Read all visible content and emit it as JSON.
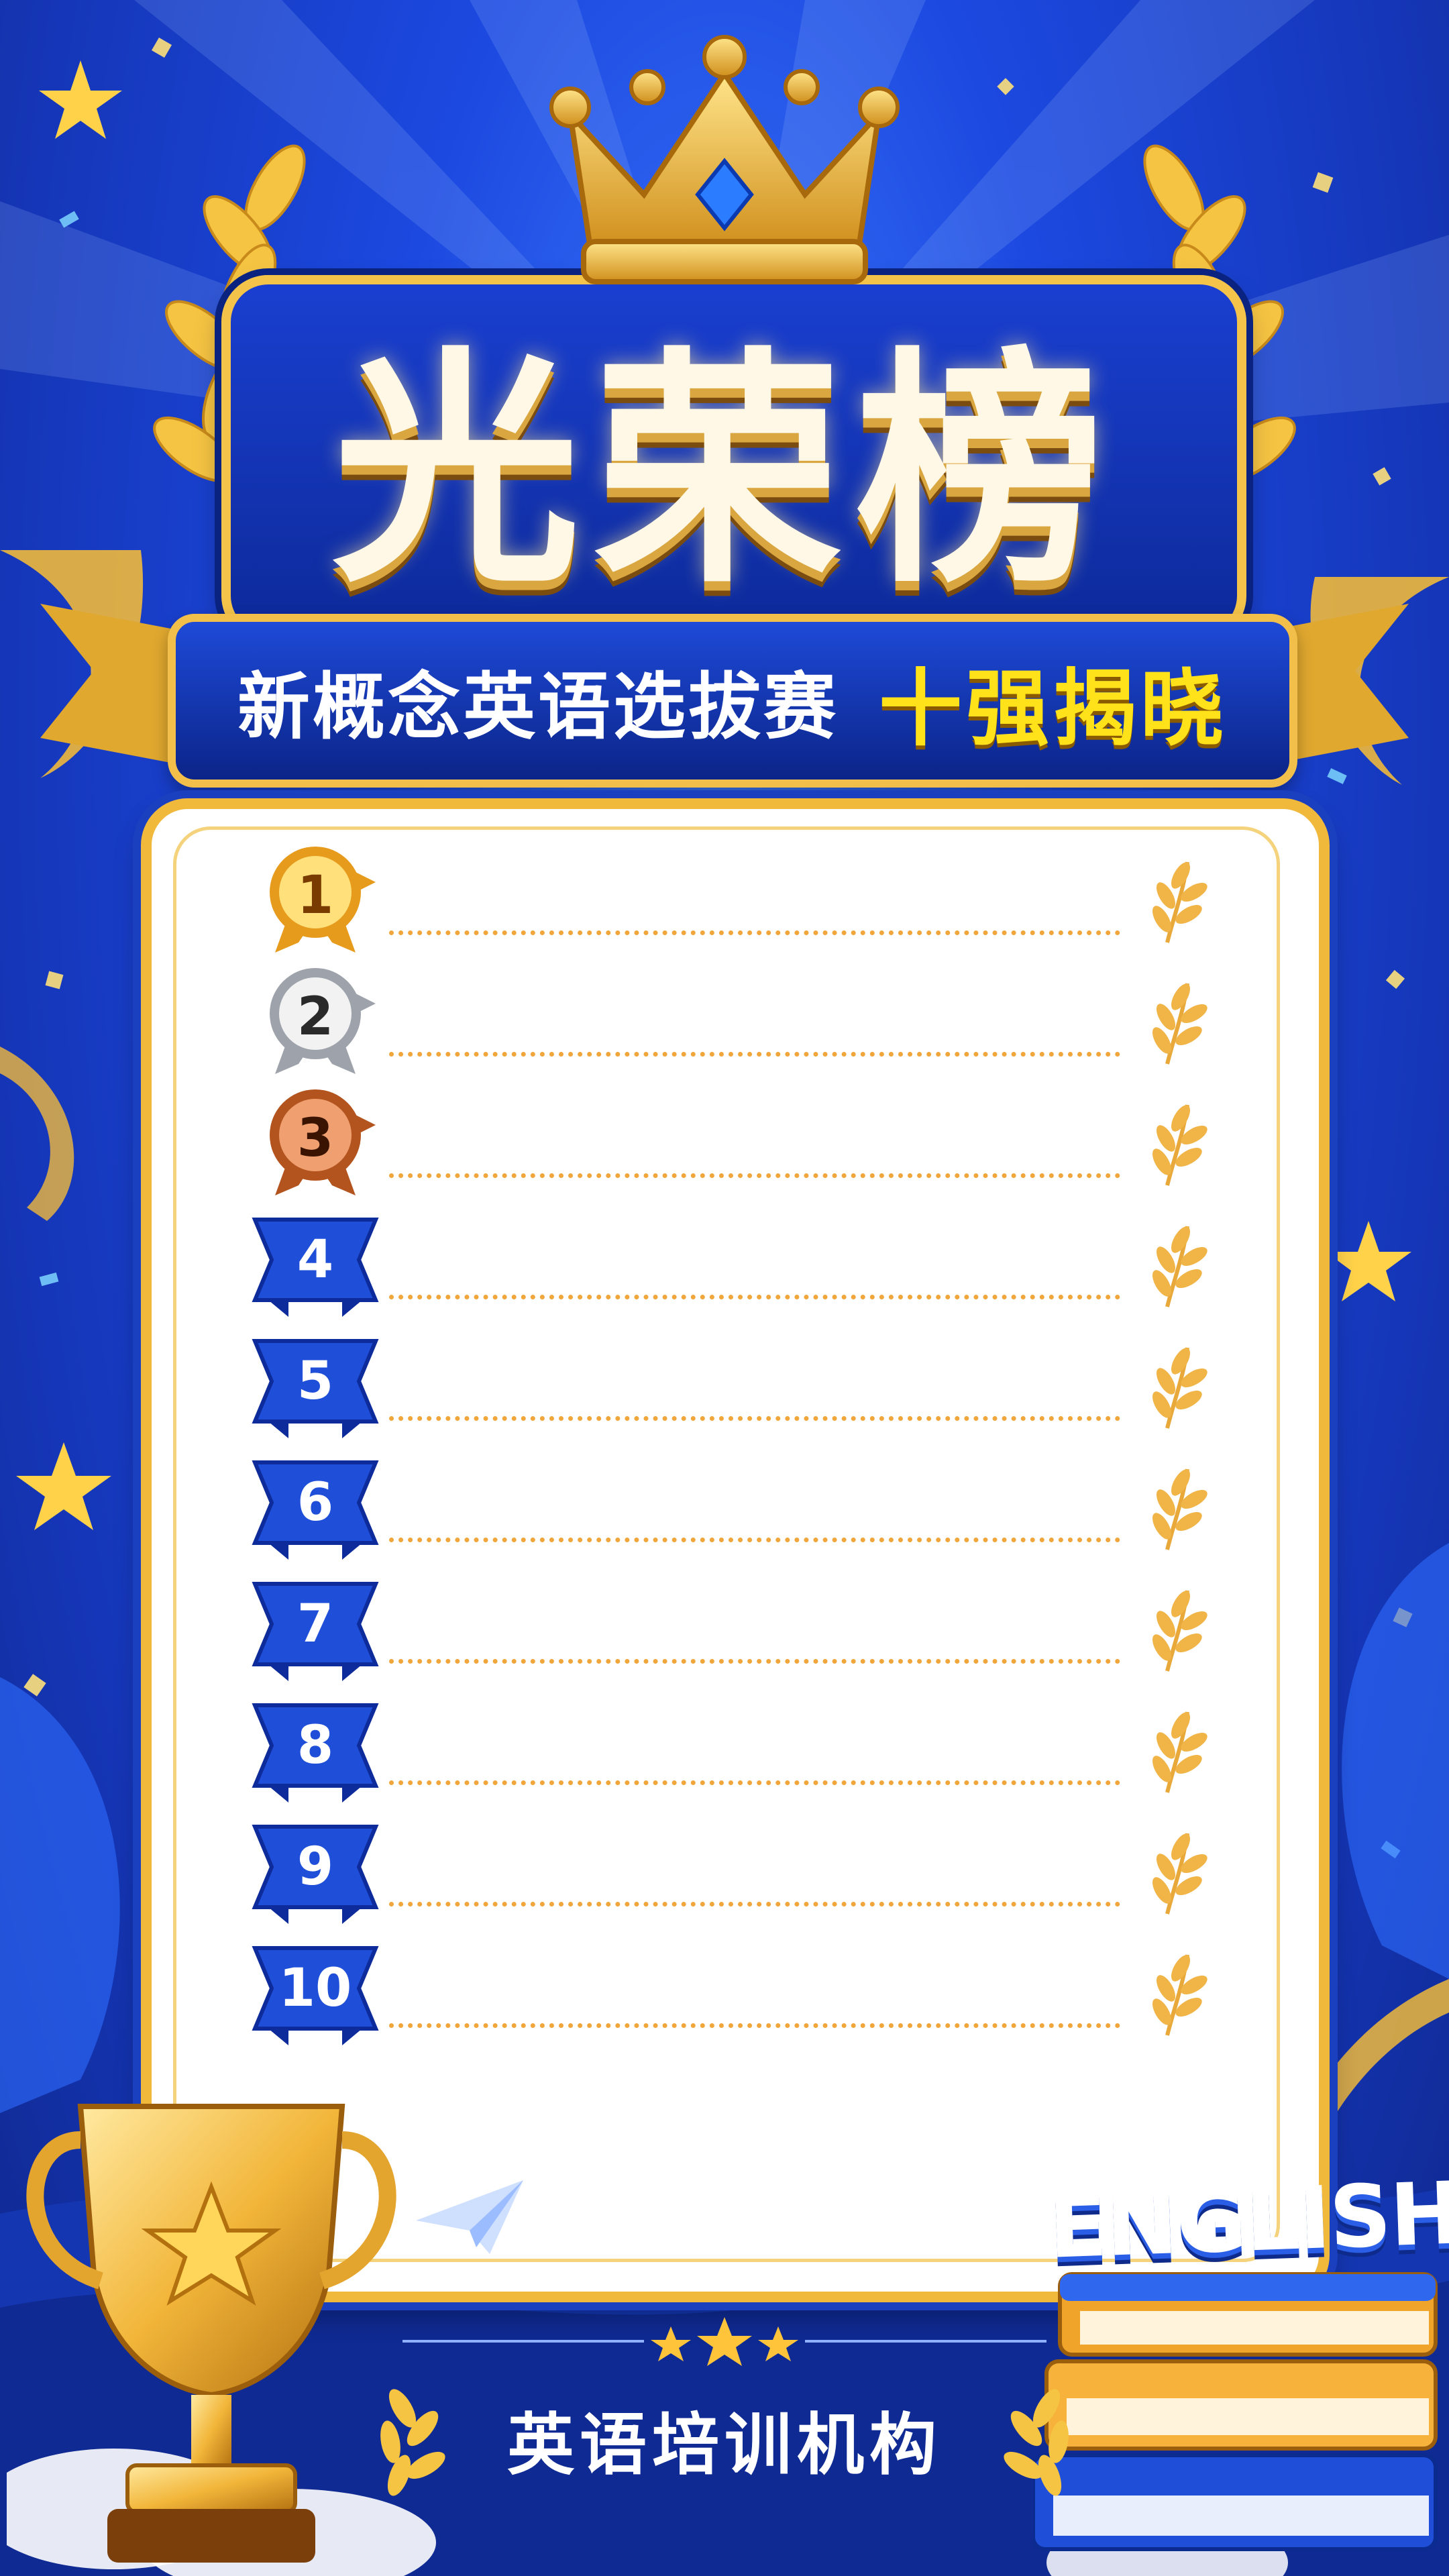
{
  "poster": {
    "title": "光荣榜",
    "subtitle": "新概念英语选拔赛",
    "highlight": "十强揭晓",
    "organization": "英语培训机构",
    "english_label": "ENGLISH"
  },
  "ranking": {
    "entries": [
      {
        "rank": "1",
        "medal": "gold"
      },
      {
        "rank": "2",
        "medal": "silver"
      },
      {
        "rank": "3",
        "medal": "bronze"
      },
      {
        "rank": "4",
        "medal": "blue-ribbon"
      },
      {
        "rank": "5",
        "medal": "blue-ribbon"
      },
      {
        "rank": "6",
        "medal": "blue-ribbon"
      },
      {
        "rank": "7",
        "medal": "blue-ribbon"
      },
      {
        "rank": "8",
        "medal": "blue-ribbon"
      },
      {
        "rank": "9",
        "medal": "blue-ribbon"
      },
      {
        "rank": "10",
        "medal": "blue-ribbon"
      }
    ]
  },
  "colors": {
    "background_blue": "#1c49e0",
    "gold": "#f0b93c",
    "highlight_yellow": "#ffe21a",
    "card": "#ffffff",
    "dotted_line": "#f0a63a"
  },
  "icons": [
    "crown-icon",
    "laurel-icon",
    "trophy-icon",
    "book-stack-icon",
    "star-icon",
    "paper-plane-icon",
    "cloud-icon"
  ]
}
